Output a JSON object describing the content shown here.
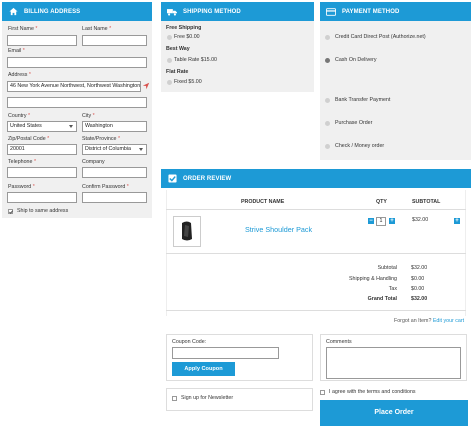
{
  "billing": {
    "title": "BILLING ADDRESS",
    "first_name_label": "First Name",
    "last_name_label": "Last Name",
    "email_label": "Email",
    "address_label": "Address",
    "address_value": "46 New York Avenue Northwest, Northwest Washington",
    "country_label": "Country",
    "country_value": "United States",
    "city_label": "City",
    "city_value": "Washington",
    "zip_label": "Zip/Postal Code",
    "zip_value": "20001",
    "state_label": "State/Province",
    "state_value": "District of Columbia",
    "telephone_label": "Telephone",
    "company_label": "Company",
    "password_label": "Password",
    "confirm_password_label": "Confirm Password",
    "ship_same_label": "Ship to same address",
    "required_mark": "*"
  },
  "shipping": {
    "title": "SHIPPING METHOD",
    "groups": [
      {
        "name": "Free Shipping",
        "option": "Free $0.00"
      },
      {
        "name": "Best Way",
        "option": "Table Rate $15.00"
      },
      {
        "name": "Flat Rate",
        "option": "Fixed $5.00"
      }
    ]
  },
  "payment": {
    "title": "PAYMENT METHOD",
    "options": [
      "Credit Card Direct Post (Authorize.net)",
      "Cash On Delivery",
      "Bank Transfer Payment",
      "Purchase Order",
      "Check / Money order"
    ]
  },
  "review": {
    "title": "ORDER REVIEW",
    "col_product": "PRODUCT NAME",
    "col_qty": "QTY",
    "col_subtotal": "SUBTOTAL",
    "product_name": "Strive Shoulder Pack",
    "qty": "1",
    "price": "$32.00",
    "minus": "−",
    "plus": "+",
    "totals": [
      {
        "label": "Subtotal",
        "value": "$32.00"
      },
      {
        "label": "Shipping & Handling",
        "value": "$0.00"
      },
      {
        "label": "Tax",
        "value": "$0.00"
      },
      {
        "label": "Grand Total",
        "value": "$32.00"
      }
    ],
    "forgot_text": "Forgot an Item?",
    "edit_cart": "Edit your cart"
  },
  "coupon": {
    "label": "Coupon Code:",
    "button": "Apply Coupon"
  },
  "comments": {
    "label": "Comments"
  },
  "newsletter": {
    "label": "Sign up for Newsletter"
  },
  "terms": {
    "label": "I agree with the terms and conditions"
  },
  "place_order": "Place Order",
  "colors": {
    "accent": "#1d9ad6",
    "required": "#d9534f",
    "link": "#1d9ad6"
  }
}
